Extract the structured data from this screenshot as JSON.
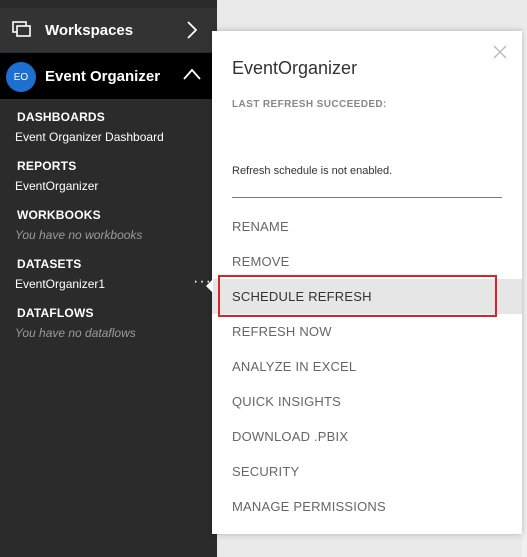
{
  "sidebar": {
    "workspaces_label": "Workspaces",
    "workspace": {
      "avatar": "EO",
      "name": "Event Organizer"
    },
    "sections": [
      {
        "title": "DASHBOARDS",
        "item": "Event Organizer Dashboard",
        "empty": false
      },
      {
        "title": "REPORTS",
        "item": "EventOrganizer",
        "empty": false
      },
      {
        "title": "WORKBOOKS",
        "item": "You have no workbooks",
        "empty": true
      },
      {
        "title": "DATASETS",
        "item": "EventOrganizer1",
        "empty": false
      },
      {
        "title": "DATAFLOWS",
        "item": "You have no dataflows",
        "empty": true
      }
    ],
    "more_options": "···"
  },
  "panel": {
    "title": "EventOrganizer",
    "status": "LAST REFRESH SUCCEEDED:",
    "schedule_text": "Refresh schedule is not enabled.",
    "menu": [
      "RENAME",
      "REMOVE",
      "SCHEDULE REFRESH",
      "REFRESH NOW",
      "ANALYZE IN EXCEL",
      "QUICK INSIGHTS",
      "DOWNLOAD .PBIX",
      "SECURITY",
      "MANAGE PERMISSIONS"
    ],
    "active_item": "SCHEDULE REFRESH"
  },
  "colors": {
    "sidebar_bg": "#2b2b2b",
    "avatar_bg": "#1d6fd0",
    "highlight": "#d9232d"
  }
}
